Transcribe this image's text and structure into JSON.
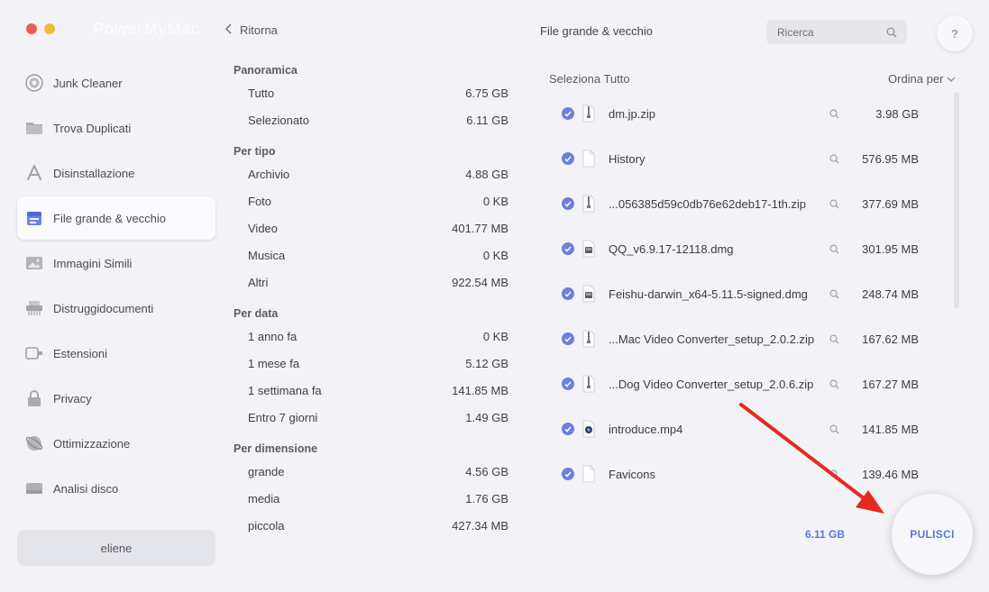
{
  "app": {
    "name": "PowerMyMac",
    "back_label": "Ritorna",
    "title": "File grande & vecchio"
  },
  "search": {
    "placeholder": "Ricerca"
  },
  "help": {
    "label": "?"
  },
  "colors": {
    "accent": "#6e7fde",
    "accent_text": "#5b78d6",
    "arrow": "#e62a1f"
  },
  "sidebar": {
    "items": [
      {
        "label": "Junk Cleaner",
        "icon": "junk-cleaner-icon"
      },
      {
        "label": "Trova Duplicati",
        "icon": "folder-icon"
      },
      {
        "label": "Disinstallazione",
        "icon": "app-store-icon"
      },
      {
        "label": "File grande & vecchio",
        "icon": "large-files-icon",
        "active": true
      },
      {
        "label": "Immagini Simili",
        "icon": "photo-icon"
      },
      {
        "label": "Distruggidocumenti",
        "icon": "shredder-icon"
      },
      {
        "label": "Estensioni",
        "icon": "extension-icon"
      },
      {
        "label": "Privacy",
        "icon": "lock-icon"
      },
      {
        "label": "Ottimizzazione",
        "icon": "optimization-icon"
      },
      {
        "label": "Analisi disco",
        "icon": "disk-icon"
      }
    ],
    "user": "eliene"
  },
  "overview": {
    "panoramica": {
      "title": "Panoramica",
      "rows": [
        {
          "label": "Tutto",
          "value": "6.75 GB"
        },
        {
          "label": "Selezionato",
          "value": "6.11 GB"
        }
      ]
    },
    "per_tipo": {
      "title": "Per tipo",
      "rows": [
        {
          "label": "Archivio",
          "value": "4.88 GB"
        },
        {
          "label": "Foto",
          "value": "0 KB"
        },
        {
          "label": "Video",
          "value": "401.77 MB"
        },
        {
          "label": "Musica",
          "value": "0 KB"
        },
        {
          "label": "Altri",
          "value": "922.54 MB"
        }
      ]
    },
    "per_data": {
      "title": "Per data",
      "rows": [
        {
          "label": "1 anno fa",
          "value": "0 KB"
        },
        {
          "label": "1 mese fa",
          "value": "5.12 GB"
        },
        {
          "label": "1 settimana fa",
          "value": "141.85 MB"
        },
        {
          "label": "Entro 7 giorni",
          "value": "1.49 GB"
        }
      ]
    },
    "per_dimensione": {
      "title": "Per dimensione",
      "rows": [
        {
          "label": "grande",
          "value": "4.56 GB"
        },
        {
          "label": "media",
          "value": "1.76 GB"
        },
        {
          "label": "piccola",
          "value": "427.34 MB"
        }
      ]
    }
  },
  "list": {
    "select_all": "Seleziona Tutto",
    "sort_label": "Ordina per",
    "files": [
      {
        "name": "dm.jp.zip",
        "size": "3.98 GB",
        "icon": "zip-file-icon",
        "checked": true
      },
      {
        "name": "History",
        "size": "576.95 MB",
        "icon": "document-icon",
        "checked": true
      },
      {
        "name": "...056385d59c0db76e62deb17-1th.zip",
        "size": "377.69 MB",
        "icon": "zip-file-icon",
        "checked": true
      },
      {
        "name": "QQ_v6.9.17-12118.dmg",
        "size": "301.95 MB",
        "icon": "dmg-file-icon",
        "checked": true
      },
      {
        "name": "Feishu-darwin_x64-5.11.5-signed.dmg",
        "size": "248.74 MB",
        "icon": "dmg-file-icon",
        "checked": true
      },
      {
        "name": "...Mac Video Converter_setup_2.0.2.zip",
        "size": "167.62 MB",
        "icon": "zip-file-icon",
        "checked": true
      },
      {
        "name": "...Dog Video Converter_setup_2.0.6.zip",
        "size": "167.27 MB",
        "icon": "zip-file-icon",
        "checked": true
      },
      {
        "name": "introduce.mp4",
        "size": "141.85 MB",
        "icon": "video-file-icon",
        "checked": true
      },
      {
        "name": "Favicons",
        "size": "139.46 MB",
        "icon": "document-icon",
        "checked": true
      }
    ],
    "total": "6.11 GB",
    "clean_label": "PULISCI"
  }
}
